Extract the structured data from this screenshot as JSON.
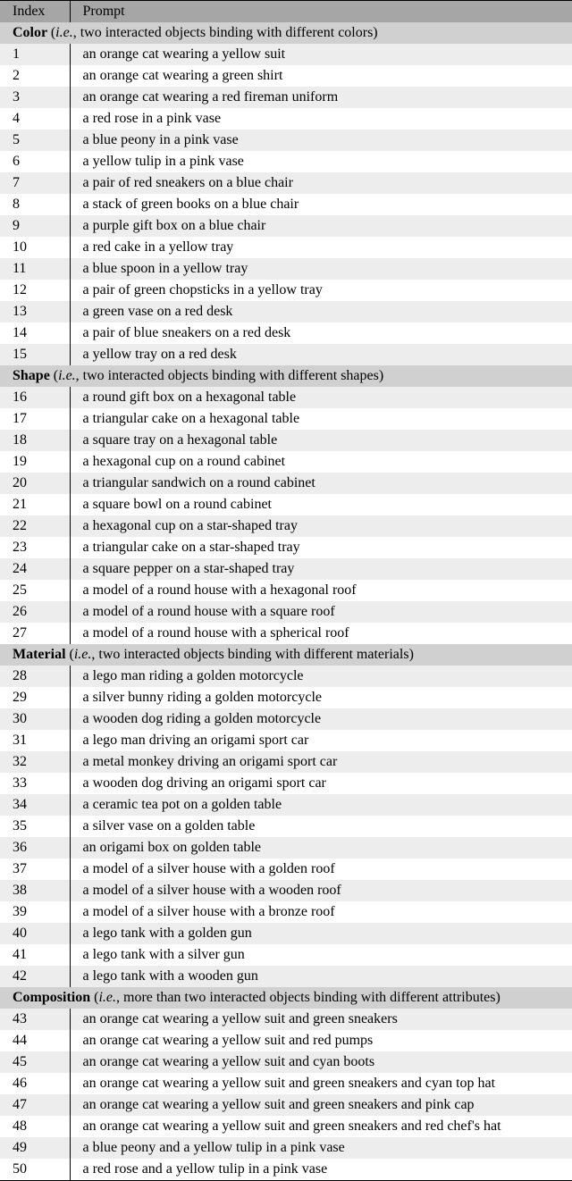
{
  "headers": {
    "index": "Index",
    "prompt": "Prompt"
  },
  "sections": [
    {
      "title_bold": "Color ",
      "title_rest": "(",
      "title_italic": "i.e.",
      "title_tail": ", two interacted objects binding with different colors)",
      "rows": [
        {
          "index": "1",
          "prompt": "an orange cat wearing a yellow suit"
        },
        {
          "index": "2",
          "prompt": "an orange cat wearing a green shirt"
        },
        {
          "index": "3",
          "prompt": "an orange cat wearing a red fireman uniform"
        },
        {
          "index": "4",
          "prompt": "a red rose in a pink vase"
        },
        {
          "index": "5",
          "prompt": "a blue peony in a pink vase"
        },
        {
          "index": "6",
          "prompt": "a yellow tulip in a pink vase"
        },
        {
          "index": "7",
          "prompt": "a pair of red sneakers on a blue chair"
        },
        {
          "index": "8",
          "prompt": "a stack of green books on a blue chair"
        },
        {
          "index": "9",
          "prompt": "a purple gift box on a blue chair"
        },
        {
          "index": "10",
          "prompt": "a red cake in a yellow tray"
        },
        {
          "index": "11",
          "prompt": "a blue spoon in a yellow tray"
        },
        {
          "index": "12",
          "prompt": "a pair of green chopsticks in a yellow tray"
        },
        {
          "index": "13",
          "prompt": "a green vase on a red desk"
        },
        {
          "index": "14",
          "prompt": "a pair of blue sneakers on a red desk"
        },
        {
          "index": "15",
          "prompt": "a yellow tray on a red desk"
        }
      ]
    },
    {
      "title_bold": "Shape ",
      "title_rest": "(",
      "title_italic": "i.e.",
      "title_tail": ", two interacted objects binding with different shapes)",
      "rows": [
        {
          "index": "16",
          "prompt": "a round gift box on a hexagonal table"
        },
        {
          "index": "17",
          "prompt": "a triangular cake on a hexagonal table"
        },
        {
          "index": "18",
          "prompt": "a square tray on a hexagonal table"
        },
        {
          "index": "19",
          "prompt": "a hexagonal cup on a round cabinet"
        },
        {
          "index": "20",
          "prompt": "a triangular sandwich on a round cabinet"
        },
        {
          "index": "21",
          "prompt": "a square bowl on a round cabinet"
        },
        {
          "index": "22",
          "prompt": "a hexagonal cup on a star-shaped tray"
        },
        {
          "index": "23",
          "prompt": "a triangular cake on a star-shaped tray"
        },
        {
          "index": "24",
          "prompt": "a square pepper on a star-shaped tray"
        },
        {
          "index": "25",
          "prompt": "a model of a round house with a hexagonal roof"
        },
        {
          "index": "26",
          "prompt": "a model of a round house with a square roof"
        },
        {
          "index": "27",
          "prompt": "a model of a round house with a spherical roof"
        }
      ]
    },
    {
      "title_bold": "Material ",
      "title_rest": "(",
      "title_italic": "i.e.",
      "title_tail": ", two interacted objects binding with different materials)",
      "rows": [
        {
          "index": "28",
          "prompt": "a lego man riding a golden motorcycle"
        },
        {
          "index": "29",
          "prompt": "a silver bunny riding a golden motorcycle"
        },
        {
          "index": "30",
          "prompt": "a wooden dog riding a golden motorcycle"
        },
        {
          "index": "31",
          "prompt": "a lego man driving an origami sport car"
        },
        {
          "index": "32",
          "prompt": "a metal monkey driving an origami sport car"
        },
        {
          "index": "33",
          "prompt": "a wooden dog driving an origami sport car"
        },
        {
          "index": "34",
          "prompt": "a ceramic tea pot on a golden table"
        },
        {
          "index": "35",
          "prompt": "a silver vase on a golden table"
        },
        {
          "index": "36",
          "prompt": "an origami box on golden table"
        },
        {
          "index": "37",
          "prompt": "a model of a silver house with a golden roof"
        },
        {
          "index": "38",
          "prompt": "a model of a silver house with a wooden roof"
        },
        {
          "index": "39",
          "prompt": "a model of a silver house with a bronze roof"
        },
        {
          "index": "40",
          "prompt": "a lego tank with a golden gun"
        },
        {
          "index": "41",
          "prompt": "a lego tank with a silver gun"
        },
        {
          "index": "42",
          "prompt": "a lego tank with a wooden gun"
        }
      ]
    },
    {
      "title_bold": "Composition ",
      "title_rest": "(",
      "title_italic": "i.e.",
      "title_tail": ", more than two interacted objects binding with different attributes)",
      "rows": [
        {
          "index": "43",
          "prompt": "an orange cat wearing a yellow suit and green sneakers"
        },
        {
          "index": "44",
          "prompt": "an orange cat wearing a yellow suit and red pumps"
        },
        {
          "index": "45",
          "prompt": "an orange cat wearing a yellow suit and cyan boots"
        },
        {
          "index": "46",
          "prompt": "an orange cat wearing a yellow suit and green sneakers and cyan top hat"
        },
        {
          "index": "47",
          "prompt": "an orange cat wearing a yellow suit and green sneakers and pink cap"
        },
        {
          "index": "48",
          "prompt": "an orange cat wearing a yellow suit and green sneakers and red chef's hat"
        },
        {
          "index": "49",
          "prompt": "a blue peony and a yellow tulip in a pink vase"
        },
        {
          "index": "50",
          "prompt": "a red rose and a yellow tulip in a pink vase"
        }
      ]
    }
  ]
}
